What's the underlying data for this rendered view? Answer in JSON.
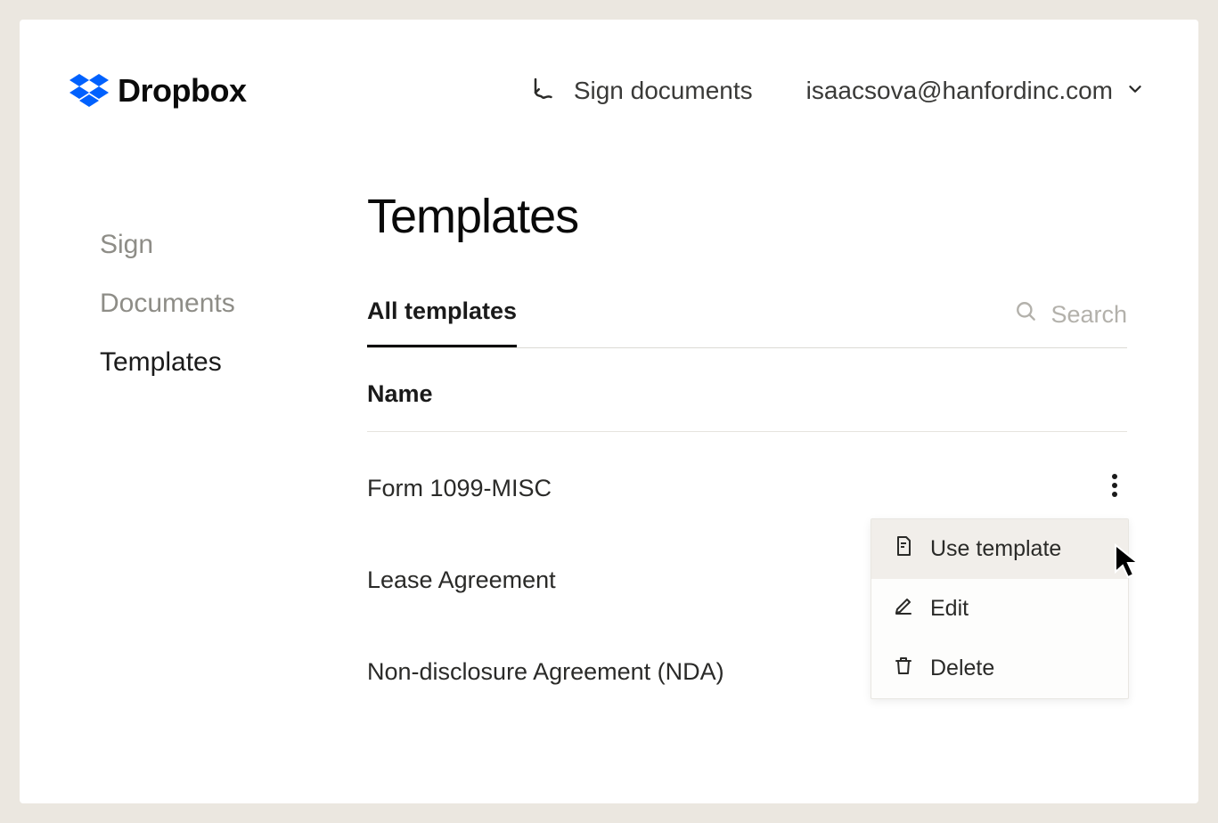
{
  "brand": {
    "name": "Dropbox"
  },
  "topbar": {
    "sign_documents": "Sign documents",
    "account_email": "isaacsova@hanfordinc.com"
  },
  "sidebar": {
    "items": [
      {
        "label": "Sign",
        "active": false
      },
      {
        "label": "Documents",
        "active": false
      },
      {
        "label": "Templates",
        "active": true
      }
    ]
  },
  "main": {
    "title": "Templates",
    "tabs": [
      {
        "label": "All templates",
        "active": true
      }
    ],
    "search_placeholder": "Search",
    "column_header": "Name",
    "rows": [
      {
        "name": "Form 1099-MISC"
      },
      {
        "name": "Lease Agreement"
      },
      {
        "name": "Non-disclosure Agreement (NDA)"
      }
    ],
    "row_menu": [
      {
        "label": "Use template",
        "icon": "document-icon",
        "hover": true
      },
      {
        "label": "Edit",
        "icon": "pencil-icon",
        "hover": false
      },
      {
        "label": "Delete",
        "icon": "trash-icon",
        "hover": false
      }
    ]
  }
}
